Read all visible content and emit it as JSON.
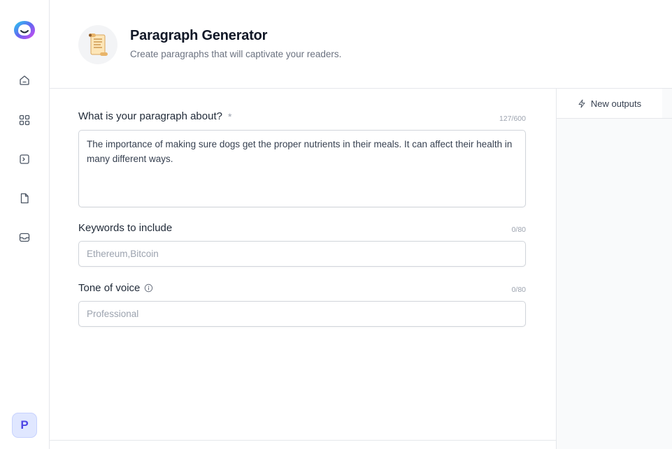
{
  "sidebar": {
    "items": [
      {
        "name": "home",
        "icon": "home-icon"
      },
      {
        "name": "templates",
        "icon": "grid-icon"
      },
      {
        "name": "commands",
        "icon": "terminal-icon"
      },
      {
        "name": "documents",
        "icon": "document-icon"
      },
      {
        "name": "inbox",
        "icon": "inbox-icon"
      }
    ],
    "avatar_initial": "P"
  },
  "header": {
    "title": "Paragraph Generator",
    "subtitle": "Create paragraphs that will captivate your readers."
  },
  "form": {
    "topic": {
      "label": "What is your paragraph about?",
      "required_mark": "*",
      "counter": "127/600",
      "value": "The importance of making sure dogs get the proper nutrients in their meals. It can affect their health in many different ways."
    },
    "keywords": {
      "label": "Keywords to include",
      "counter": "0/80",
      "placeholder": "Ethereum,Bitcoin"
    },
    "tone": {
      "label": "Tone of voice",
      "counter": "0/80",
      "placeholder": "Professional"
    }
  },
  "outputs": {
    "tab_label": "New outputs"
  },
  "colors": {
    "accent": "#4f46e5",
    "border": "#e5e7eb"
  }
}
